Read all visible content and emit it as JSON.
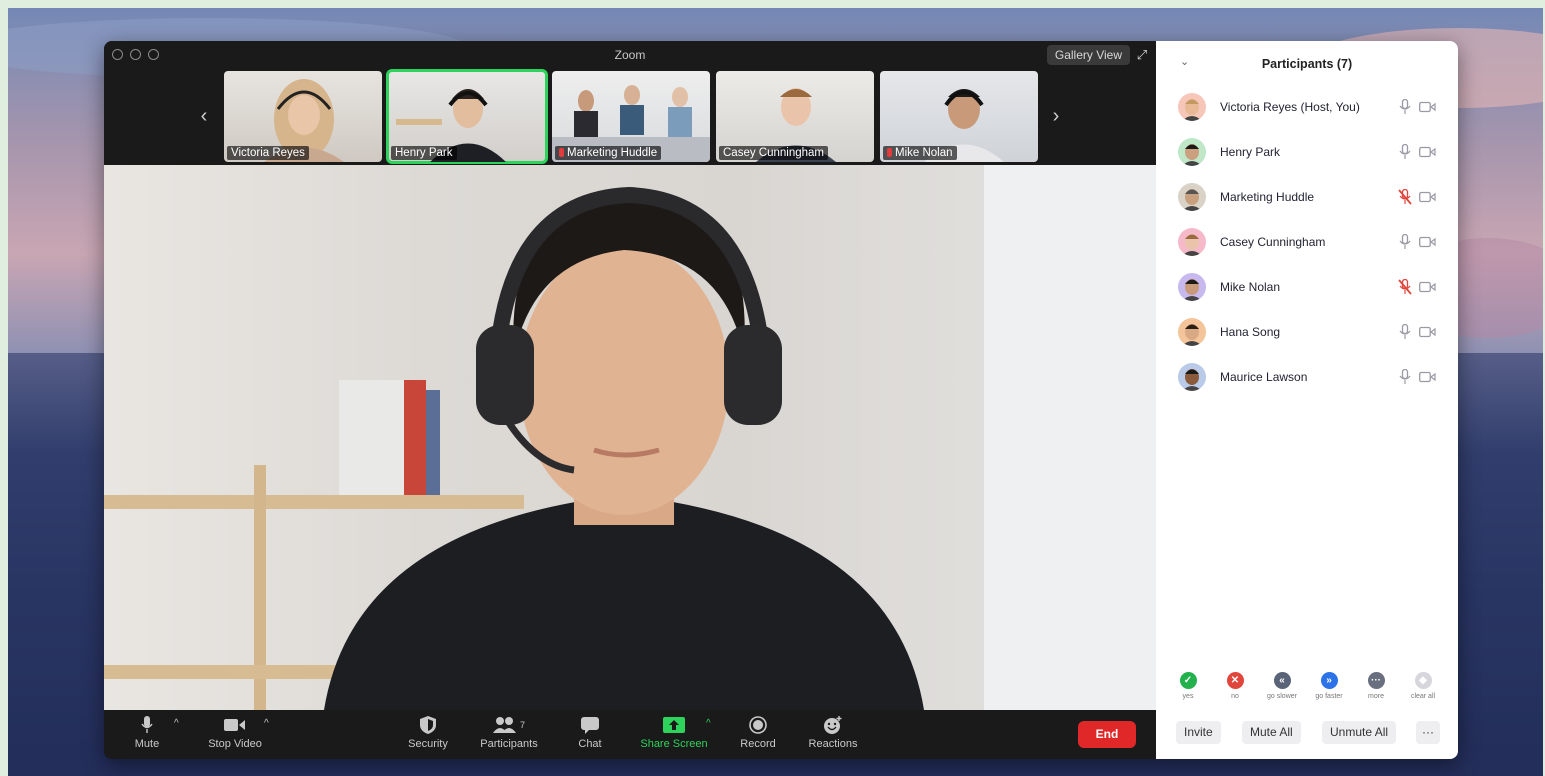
{
  "window": {
    "title": "Zoom",
    "gallery_view_label": "Gallery View"
  },
  "thumbnails": [
    {
      "name": "Victoria Reyes",
      "muted": false,
      "active": false
    },
    {
      "name": "Henry Park",
      "muted": false,
      "active": true
    },
    {
      "name": "Marketing Huddle",
      "muted": true,
      "active": false
    },
    {
      "name": "Casey Cunningham",
      "muted": false,
      "active": false
    },
    {
      "name": "Mike Nolan",
      "muted": true,
      "active": false
    }
  ],
  "toolbar": {
    "mute": "Mute",
    "stop_video": "Stop Video",
    "security": "Security",
    "participants": "Participants",
    "participants_count": "7",
    "chat": "Chat",
    "share_screen": "Share Screen",
    "record": "Record",
    "reactions": "Reactions",
    "end": "End"
  },
  "panel": {
    "title": "Participants (7)",
    "participants": [
      {
        "name": "Victoria Reyes (Host, You)",
        "muted": false
      },
      {
        "name": "Henry Park",
        "muted": false
      },
      {
        "name": "Marketing Huddle",
        "muted": true
      },
      {
        "name": "Casey Cunningham",
        "muted": false
      },
      {
        "name": "Mike Nolan",
        "muted": true
      },
      {
        "name": "Hana Song",
        "muted": false
      },
      {
        "name": "Maurice Lawson",
        "muted": false
      }
    ],
    "feedback": [
      {
        "label": "yes",
        "color": "#22b14c",
        "glyph": "✓"
      },
      {
        "label": "no",
        "color": "#e0463b",
        "glyph": "✕"
      },
      {
        "label": "go slower",
        "color": "#5a6478",
        "glyph": "«"
      },
      {
        "label": "go faster",
        "color": "#2d73e8",
        "glyph": "»"
      },
      {
        "label": "more",
        "color": "#6a6f80",
        "glyph": "···"
      },
      {
        "label": "clear all",
        "color": "#d6d6dc",
        "glyph": "◆"
      }
    ],
    "buttons": {
      "invite": "Invite",
      "mute_all": "Mute All",
      "unmute_all": "Unmute All",
      "more": "···"
    }
  },
  "colors": {
    "accent_green": "#2dd35a",
    "end_red": "#e02828",
    "muted_red": "#e0463b"
  }
}
